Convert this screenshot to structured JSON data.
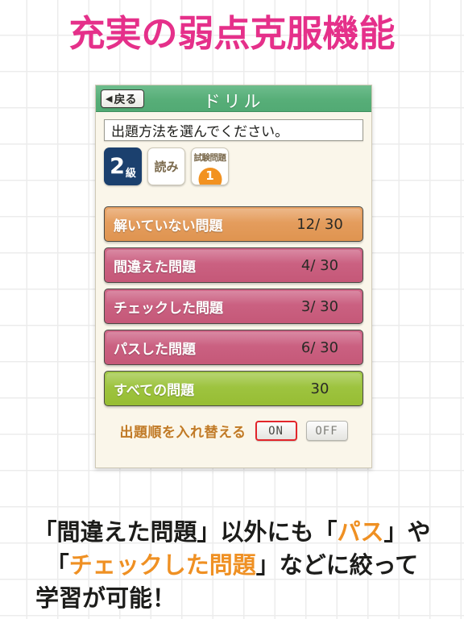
{
  "headline": "充実の弱点克服機能",
  "phone": {
    "nav": {
      "back_label": "戻る",
      "back_arrow": "◀",
      "title": "ドリル"
    },
    "prompt": "出題方法を選んでください。",
    "badges": {
      "grade_number": "2",
      "grade_suffix": "級",
      "reading_label": "読み",
      "exam_label": "試験問題",
      "exam_count": "1"
    },
    "rows": [
      {
        "label": "解いていない問題",
        "count": "12/ 30",
        "color": "#e39a5c",
        "style": "orange"
      },
      {
        "label": "間違えた問題",
        "count": "4/ 30",
        "color": "#ca5e80",
        "style": "pink"
      },
      {
        "label": "チェックした問題",
        "count": "3/ 30",
        "color": "#ca5e80",
        "style": "pink"
      },
      {
        "label": "パスした問題",
        "count": "6/ 30",
        "color": "#ca5e80",
        "style": "pink"
      },
      {
        "label": "すべての問題",
        "count": "30",
        "color": "#9cc23b",
        "style": "green"
      }
    ],
    "shuffle": {
      "label": "出題順を入れ替える",
      "on_label": "ON",
      "off_label": "OFF",
      "selected": "ON"
    }
  },
  "caption": {
    "line1_a": "「間違えた問題」以外にも「",
    "line1_hl": "パス",
    "line1_b": "」や",
    "line2_a": "「",
    "line2_hl": "チェックした問題",
    "line2_b": "」などに絞って",
    "line3": "学習が可能！"
  },
  "colors": {
    "headline_pink": "#e5308a",
    "nav_green": "#57ae78",
    "panel_cream": "#faf6ea",
    "accent_orange": "#ef9023",
    "grade_navy": "#1b406e",
    "badge_orange": "#f29221",
    "on_border_red": "#e2252b"
  }
}
